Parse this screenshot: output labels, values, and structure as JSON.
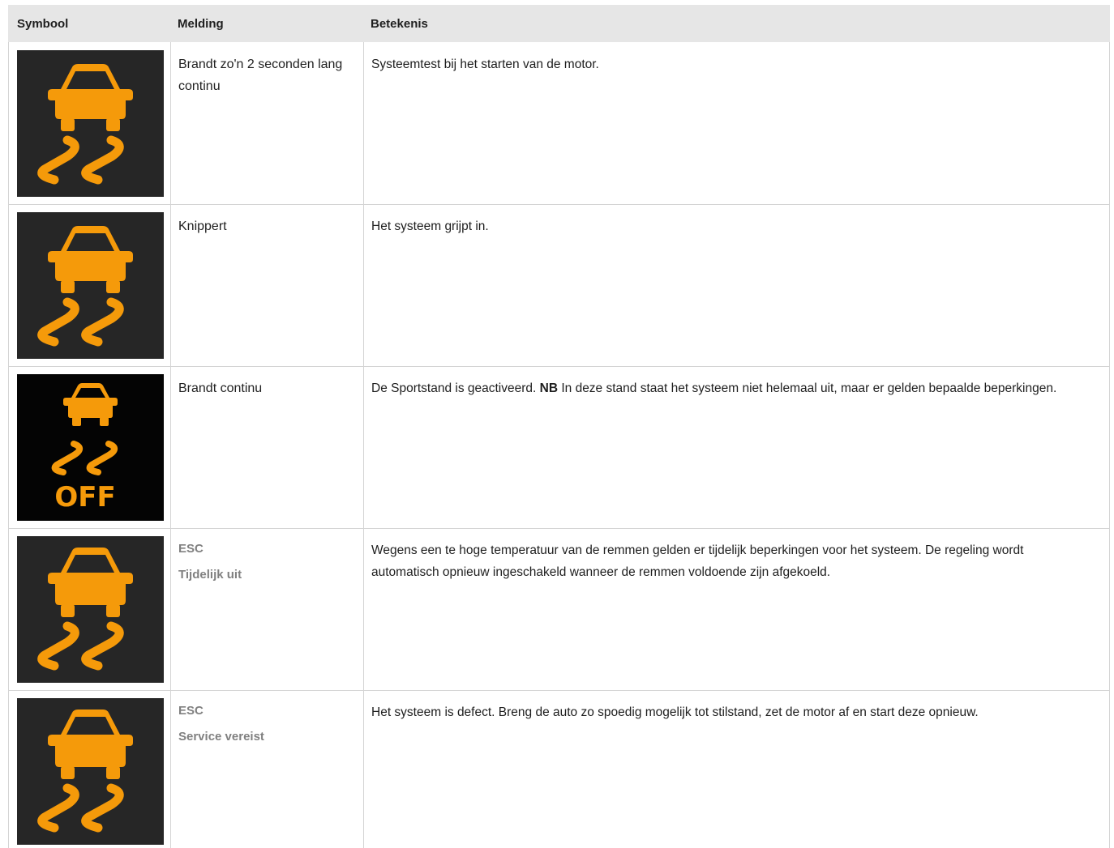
{
  "header": {
    "symbol": "Symbool",
    "message": "Melding",
    "meaning": "Betekenis"
  },
  "colors": {
    "icon_orange": "#f59a0a",
    "icon_bg": "#262626",
    "icon_bg_off": "#040404"
  },
  "rows": [
    {
      "icon": "traction-control-icon",
      "message": "Brandt zo'n 2 seconden lang continu",
      "meaning": "Systeemtest bij het starten van de motor."
    },
    {
      "icon": "traction-control-icon",
      "message": "Knippert",
      "meaning": "Het systeem grijpt in."
    },
    {
      "icon": "traction-control-off-icon",
      "icon_text": "OFF",
      "message": "Brandt continu",
      "meaning_bold": "NB",
      "meaning_before": "De Sportstand is geactiveerd. ",
      "meaning_after": " In deze stand staat het systeem niet helemaal uit, maar er gelden bepaalde beperkingen."
    },
    {
      "icon": "traction-control-icon",
      "message_line1": "ESC",
      "message_line2": "Tijdelijk uit",
      "meaning": "Wegens een te hoge temperatuur van de remmen gelden er tijdelijk beperkingen voor het systeem. De regeling wordt automatisch opnieuw ingeschakeld wanneer de remmen voldoende zijn afgekoeld."
    },
    {
      "icon": "traction-control-icon",
      "message_line1": "ESC",
      "message_line2": "Service vereist",
      "meaning": "Het systeem is defect. Breng de auto zo spoedig mogelijk tot stilstand, zet de motor af en start deze opnieuw."
    }
  ]
}
